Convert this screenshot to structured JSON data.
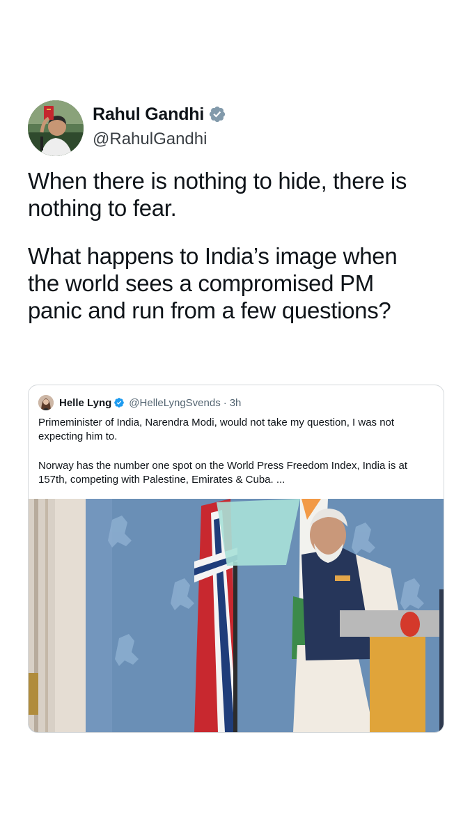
{
  "tweet": {
    "author_name": "Rahul Gandhi",
    "author_handle": "@RahulGandhi",
    "verified": true,
    "paragraph_1": "When there is nothing to hide, there is nothing to fear.",
    "paragraph_2": "What happens to India’s image when the world sees a compromised PM panic and run from a few questions?"
  },
  "quoted_tweet": {
    "author_name": "Helle Lyng",
    "author_handle": "@HelleLyngSvends",
    "separator": "·",
    "time": "3h",
    "verified": true,
    "paragraph_1": "Primeminister of India, Narendra Modi, would not take my question, I was not expecting him to.",
    "paragraph_2": "Norway has the number one spot on the World Press Freedom Index, India is at 157th, competing with Palestine, Emirates & Cuba. ..."
  },
  "colors": {
    "verified_badge": "#829aab",
    "text_primary": "#0f1419",
    "text_secondary": "#536471",
    "border": "#d4d8db"
  },
  "icons": {
    "verified": "verified-badge-icon"
  }
}
